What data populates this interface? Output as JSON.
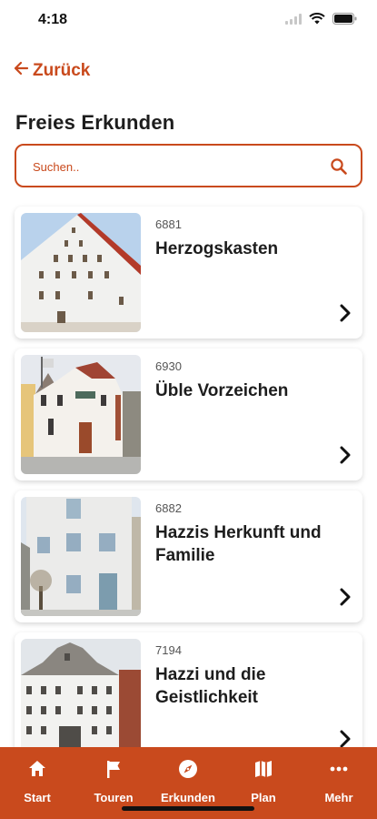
{
  "status_bar": {
    "time": "4:18"
  },
  "nav": {
    "back_label": "Zurück"
  },
  "page": {
    "title": "Freies Erkunden"
  },
  "search": {
    "placeholder": "Suchen.."
  },
  "items": [
    {
      "id": "6881",
      "title": "Herzogskasten"
    },
    {
      "id": "6930",
      "title": "Üble Vorzeichen"
    },
    {
      "id": "6882",
      "title": "Hazzis Herkunft und Familie"
    },
    {
      "id": "7194",
      "title": "Hazzi und die Geistlichkeit"
    }
  ],
  "tabs": [
    {
      "label": "Start",
      "icon": "home-icon"
    },
    {
      "label": "Touren",
      "icon": "flag-icon"
    },
    {
      "label": "Erkunden",
      "icon": "compass-icon"
    },
    {
      "label": "Plan",
      "icon": "map-icon"
    },
    {
      "label": "Mehr",
      "icon": "more-icon"
    }
  ],
  "colors": {
    "accent": "#c94a1d",
    "tab_bar": "#c94a1d"
  }
}
